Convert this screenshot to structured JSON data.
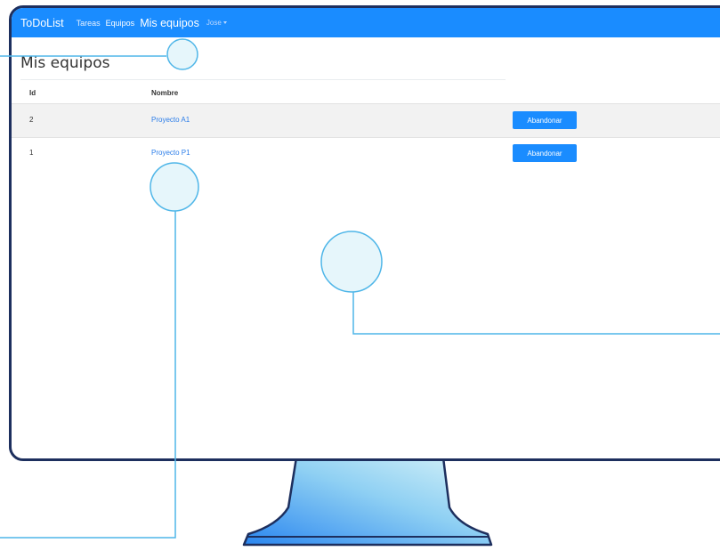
{
  "navbar": {
    "brand": "ToDoList",
    "links": [
      "Tareas",
      "Equipos",
      "Mis equipos"
    ],
    "user": "Jose"
  },
  "page": {
    "title": "Mis equipos",
    "columns": [
      "Id",
      "Nombre"
    ],
    "rows": [
      {
        "id": "2",
        "name": "Proyecto A1",
        "action": "Abandonar"
      },
      {
        "id": "1",
        "name": "Proyecto P1",
        "action": "Abandonar"
      }
    ]
  },
  "colors": {
    "navbar": "#1a8cff",
    "button": "#1a8cff",
    "link": "#2b7de9",
    "monitor_frame": "#1d2f5e",
    "callout": "#4fb6e8",
    "callout_fill": "#e6f6fb"
  }
}
